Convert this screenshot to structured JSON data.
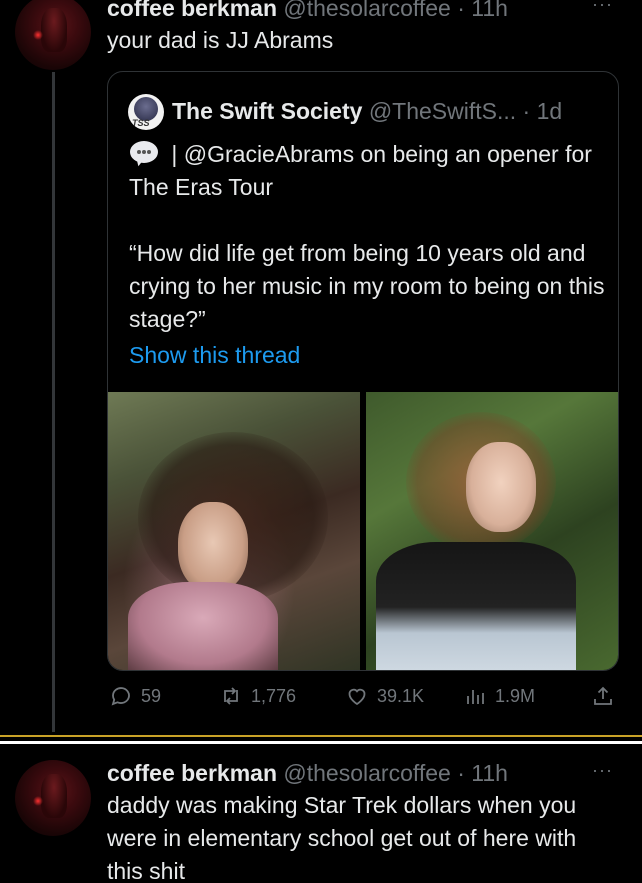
{
  "tweet1": {
    "display_name": "coffee berkman",
    "handle_time": "@thesolarcoffee · 11h",
    "text": "your dad is JJ Abrams"
  },
  "quote": {
    "display_name": "The Swift Society",
    "handle_time": "@TheSwiftS... · 1d",
    "avatar_text": "TSS",
    "line1": " | @GracieAbrams on being an opener for The Eras Tour",
    "line2": "“How did life get from being 10 years old and crying to her music in my room to being on this stage?”",
    "show_thread": "Show this thread"
  },
  "actions": {
    "replies": "59",
    "reposts": "1,776",
    "likes": "39.1K",
    "views": "1.9M"
  },
  "tweet2": {
    "display_name": "coffee berkman",
    "handle_time": "@thesolarcoffee · 11h",
    "text": "daddy was making Star Trek dollars when you were in elementary school get out of here with this shit"
  },
  "more_label": "···",
  "colors": {
    "background": "#000000",
    "text": "#e7e9ea",
    "muted": "#71767b",
    "link": "#1d9bf0",
    "border": "#2f3336",
    "separator_gold": "#c9a227"
  }
}
